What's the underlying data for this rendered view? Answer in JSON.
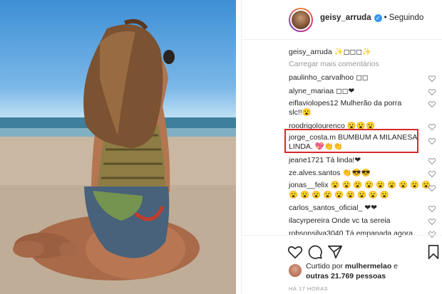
{
  "post": {
    "author": "geisy_arruda",
    "follow_status": "Seguindo",
    "caption_user": "geisy_arruda",
    "caption_text": "✨◻◻◻✨"
  },
  "comments": {
    "load_more_label": "Carregar mais comentários",
    "items": [
      {
        "user": "paulinho_carvalhoo",
        "text": "◻◻"
      },
      {
        "user": "alyne_mariaa",
        "text": "◻◻❤"
      },
      {
        "user": "eiflaviolopes12",
        "text": "Mulherão da porra"
      },
      {
        "user": "",
        "text": "slc!!😮"
      },
      {
        "user": "roodrigolourenco",
        "text": "😮😮😮"
      },
      {
        "user": "jorge_costa.m",
        "text": "BUMBUM A MILANESA"
      },
      {
        "user": "",
        "text": "LINDA. 💖👏👏"
      },
      {
        "user": "jeane1721",
        "text": "Tá linda!❤"
      },
      {
        "user": "ze.alves.santos",
        "text": "👏😎😎"
      },
      {
        "user": "jonas__felix",
        "text": "😮 😮 😮 😮 😮 😮 😮 😮 😮"
      },
      {
        "user": "",
        "text": "😮 😮 😮 😮 😮 😮 😮 😮 😮"
      },
      {
        "user": "carlos_santos_oficial_",
        "text": "❤❤"
      },
      {
        "user": "ilacyrpereira",
        "text": "Onde vc ta sereia"
      },
      {
        "user": "robsonsilva3040",
        "text": "Tá empanada agora"
      }
    ]
  },
  "likes": {
    "line1_prefix": "Curtido por",
    "line1_user": "mulhermelao",
    "line1_suffix": "e",
    "line2_prefix": "outras",
    "line2_count": "21.769",
    "line2_suffix": "pessoas"
  },
  "timestamp": "HÁ 17 HORAS",
  "colors": {
    "highlight_border": "#d62a2a",
    "verified_blue": "#3897f0",
    "muted_text": "#999999"
  },
  "icons": [
    "heart-icon",
    "comment-icon",
    "share-icon",
    "bookmark-icon",
    "verified-badge-icon"
  ]
}
